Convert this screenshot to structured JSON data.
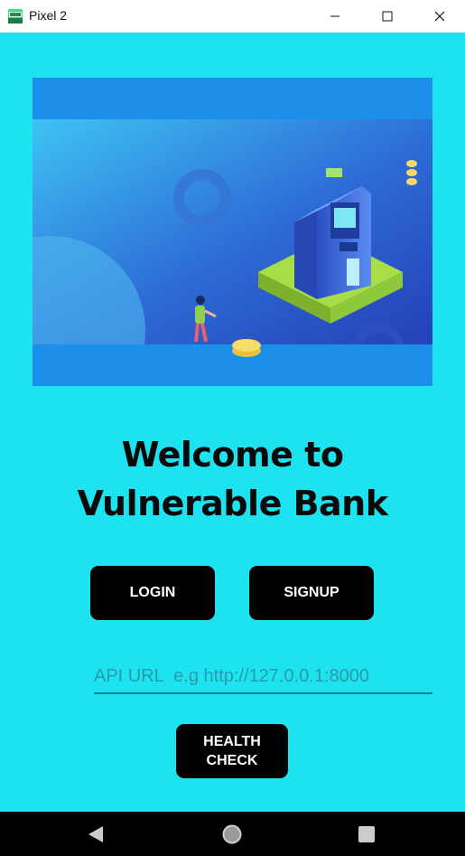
{
  "window": {
    "title": "Pixel 2",
    "minimize_icon": "minimize-icon",
    "maximize_icon": "maximize-icon",
    "close_icon": "close-icon"
  },
  "banner": {
    "image": "atm-illustration"
  },
  "welcome": {
    "line1": "Welcome to",
    "line2": "Vulnerable Bank"
  },
  "buttons": {
    "login": "LOGIN",
    "signup": "SIGNUP",
    "health_line1": "HEALTH",
    "health_line2": "CHECK"
  },
  "api_url": {
    "value": "",
    "placeholder": "API URL  e.g http://127.0.0.1:8000"
  },
  "navbar": {
    "back": "back-icon",
    "home": "home-icon",
    "recents": "recents-icon"
  },
  "colors": {
    "background": "#1de3f0",
    "banner": "#1b8fe9",
    "button": "#000000",
    "button_text": "#ffffff"
  }
}
